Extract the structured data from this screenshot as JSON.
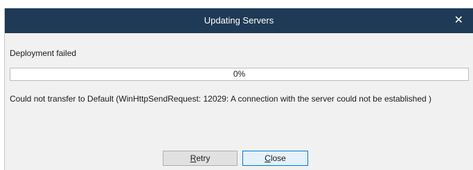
{
  "window": {
    "title": "Updating Servers",
    "close_glyph": "✕"
  },
  "status": {
    "text": "Deployment failed"
  },
  "progress": {
    "value": 0,
    "label": "0%"
  },
  "error": {
    "message": "Could not transfer to Default (WinHttpSendRequest: 12029: A connection with the server could not be established )"
  },
  "buttons": {
    "retry": {
      "mnemonic": "R",
      "rest": "etry"
    },
    "close": {
      "mnemonic": "C",
      "rest": "lose"
    }
  },
  "colors": {
    "titlebar": "#1f3a56",
    "progress_fill": "#06b025",
    "focus_border": "#0078d7"
  }
}
